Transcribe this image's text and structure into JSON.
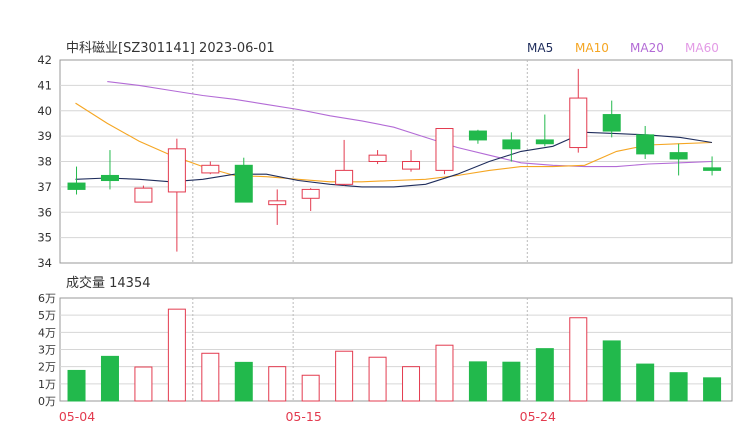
{
  "chart_title": "中科磁业[SZ301141] 2023-06-01",
  "volume_label": "成交量 14354",
  "legend": [
    {
      "name": "MA5",
      "color": "#1f2d5c"
    },
    {
      "name": "MA10",
      "color": "#f5a623"
    },
    {
      "name": "MA20",
      "color": "#b36bd6"
    },
    {
      "name": "MA60",
      "color": "#e39be6"
    }
  ],
  "colors": {
    "up": "#e33b4f",
    "down": "#22b94c",
    "grid": "#d6d6d6",
    "axis_text": "#333333",
    "date_text": "#e33b4f"
  },
  "chart_data": [
    {
      "type": "candlestick",
      "ylim": [
        34,
        42
      ],
      "yticks": [
        34,
        35,
        36,
        37,
        38,
        39,
        40,
        41,
        42
      ],
      "candles": [
        {
          "open": 37.15,
          "close": 36.9,
          "high": 37.8,
          "low": 36.7,
          "dir": "down"
        },
        {
          "open": 37.45,
          "close": 37.25,
          "high": 38.45,
          "low": 36.9,
          "dir": "down"
        },
        {
          "open": 36.4,
          "close": 36.95,
          "high": 37.05,
          "low": 36.4,
          "dir": "up"
        },
        {
          "open": 36.8,
          "close": 38.5,
          "high": 38.9,
          "low": 34.45,
          "dir": "up"
        },
        {
          "open": 37.55,
          "close": 37.85,
          "high": 38.0,
          "low": 37.5,
          "dir": "up"
        },
        {
          "open": 37.85,
          "close": 36.4,
          "high": 38.15,
          "low": 36.4,
          "dir": "down"
        },
        {
          "open": 36.3,
          "close": 36.45,
          "high": 36.9,
          "low": 35.5,
          "dir": "up"
        },
        {
          "open": 36.55,
          "close": 36.9,
          "high": 36.95,
          "low": 36.05,
          "dir": "up"
        },
        {
          "open": 37.1,
          "close": 37.65,
          "high": 38.85,
          "low": 37.05,
          "dir": "up"
        },
        {
          "open": 38.0,
          "close": 38.25,
          "high": 38.45,
          "low": 37.9,
          "dir": "up"
        },
        {
          "open": 37.7,
          "close": 38.0,
          "high": 38.45,
          "low": 37.6,
          "dir": "up"
        },
        {
          "open": 37.65,
          "close": 39.3,
          "high": 39.3,
          "low": 37.5,
          "dir": "up"
        },
        {
          "open": 39.2,
          "close": 38.85,
          "high": 39.25,
          "low": 38.7,
          "dir": "down"
        },
        {
          "open": 38.85,
          "close": 38.5,
          "high": 39.15,
          "low": 38.0,
          "dir": "down"
        },
        {
          "open": 38.85,
          "close": 38.7,
          "high": 39.85,
          "low": 38.6,
          "dir": "down"
        },
        {
          "open": 38.55,
          "close": 40.5,
          "high": 41.65,
          "low": 38.35,
          "dir": "up"
        },
        {
          "open": 39.85,
          "close": 39.2,
          "high": 40.4,
          "low": 38.95,
          "dir": "down"
        },
        {
          "open": 39.05,
          "close": 38.3,
          "high": 39.4,
          "low": 38.1,
          "dir": "down"
        },
        {
          "open": 38.35,
          "close": 38.1,
          "high": 38.7,
          "low": 37.45,
          "dir": "down"
        },
        {
          "open": 37.75,
          "close": 37.65,
          "high": 38.2,
          "low": 37.45,
          "dir": "down"
        }
      ],
      "ma5": [
        37.3,
        37.35,
        37.3,
        37.2,
        37.3,
        37.5,
        37.5,
        37.25,
        37.1,
        37.0,
        37.0,
        37.1,
        37.5,
        38.0,
        38.4,
        38.6,
        39.15,
        39.1,
        39.05,
        38.95,
        38.75
      ],
      "ma10": [
        40.3,
        39.5,
        38.8,
        38.25,
        37.8,
        37.45,
        37.4,
        37.3,
        37.2,
        37.2,
        37.25,
        37.3,
        37.45,
        37.65,
        37.8,
        37.8,
        37.85,
        38.4,
        38.65,
        38.7,
        38.75
      ],
      "ma20": [
        null,
        41.15,
        41.0,
        40.8,
        40.6,
        40.45,
        40.25,
        40.05,
        39.8,
        39.6,
        39.35,
        38.95,
        38.55,
        38.25,
        37.95,
        37.85,
        37.8,
        37.8,
        37.9,
        37.95,
        38.0
      ]
    },
    {
      "type": "bar",
      "title": "成交量",
      "ylim": [
        0,
        60000
      ],
      "ytick_labels": [
        "0万",
        "1万",
        "2万",
        "3万",
        "4万",
        "5万",
        "6万"
      ],
      "volumes": [
        17800,
        26000,
        19800,
        53500,
        27800,
        22500,
        20000,
        15000,
        29000,
        25500,
        20000,
        32500,
        22800,
        22600,
        30500,
        48500,
        35000,
        21500,
        16500,
        13500
      ],
      "dirs": [
        "down",
        "down",
        "up",
        "up",
        "up",
        "down",
        "up",
        "up",
        "up",
        "up",
        "up",
        "up",
        "down",
        "down",
        "down",
        "up",
        "down",
        "down",
        "down",
        "down"
      ],
      "x_labels": [
        {
          "label": "05-04",
          "index": 0
        },
        {
          "label": "05-15",
          "index": 7
        },
        {
          "label": "05-24",
          "index": 14
        }
      ]
    }
  ]
}
